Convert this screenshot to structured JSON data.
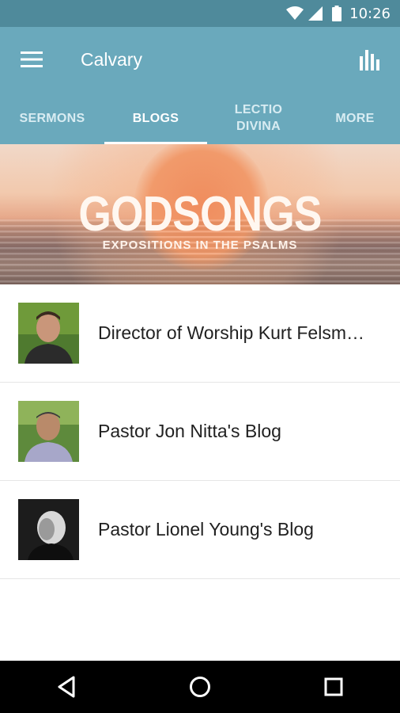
{
  "status_bar": {
    "time": "10:26",
    "icons": [
      "wifi-icon",
      "cellular-signal-icon",
      "battery-icon"
    ]
  },
  "app_bar": {
    "title": "Calvary",
    "menu_icon": "hamburger-menu-icon",
    "action_icon": "bar-chart-icon"
  },
  "tabs": [
    {
      "label": "SERMONS",
      "active": false
    },
    {
      "label": "BLOGS",
      "active": true
    },
    {
      "label": "LECTIO DIVINA",
      "active": false
    },
    {
      "label": "MORE",
      "active": false
    }
  ],
  "banner": {
    "title": "GODSONGS",
    "subtitle": "EXPOSITIONS IN THE PSALMS"
  },
  "blogs": [
    {
      "title": "Director of Worship Kurt Felsm…"
    },
    {
      "title": "Pastor Jon Nitta's Blog"
    },
    {
      "title": "Pastor Lionel Young's  Blog"
    }
  ],
  "nav_bar": {
    "icons": [
      "back-icon",
      "home-icon",
      "recents-icon"
    ]
  },
  "colors": {
    "status_bar": "#4f8a9b",
    "app_bar": "#6aa9bc",
    "tab_indicator": "#ffffff"
  }
}
